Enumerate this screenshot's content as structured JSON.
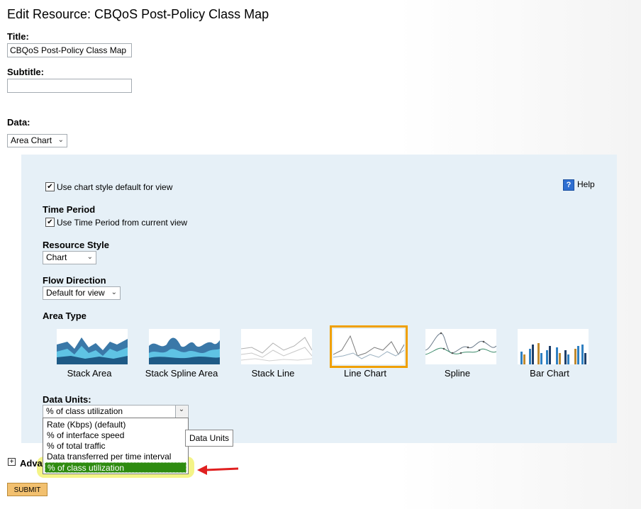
{
  "page": {
    "title": "Edit Resource: CBQoS Post-Policy Class Map"
  },
  "form": {
    "title_label": "Title:",
    "title_value": "CBQoS Post-Policy Class Map",
    "subtitle_label": "Subtitle:",
    "subtitle_value": "",
    "data_label": "Data:",
    "data_select": "Area Chart"
  },
  "panel": {
    "use_chart_style_label": "Use chart style default for view",
    "use_chart_style_checked": true,
    "help_label": "Help",
    "time_period_heading": "Time Period",
    "use_time_period_label": "Use Time Period from current view",
    "use_time_period_checked": true,
    "resource_style_heading": "Resource Style",
    "resource_style_value": "Chart",
    "flow_direction_heading": "Flow Direction",
    "flow_direction_value": "Default for view",
    "area_type_heading": "Area Type",
    "area_types": [
      {
        "label": "Stack Area",
        "icon": "stack-area-icon"
      },
      {
        "label": "Stack Spline Area",
        "icon": "stack-spline-area-icon"
      },
      {
        "label": "Stack Line",
        "icon": "stack-line-icon"
      },
      {
        "label": "Line Chart",
        "icon": "line-chart-icon",
        "selected": true
      },
      {
        "label": "Spline",
        "icon": "spline-icon"
      },
      {
        "label": "Bar Chart",
        "icon": "bar-chart-icon"
      }
    ],
    "data_units_heading": "Data Units:",
    "data_units_value": "% of class utilization",
    "data_units_options": [
      "Rate (Kbps) (default)",
      "% of interface speed",
      "% of total traffic",
      "Data transferred per time interval",
      "% of class utilization"
    ],
    "tooltip": "Data Units"
  },
  "advanced_label": "Adva",
  "submit_label": "SUBMIT",
  "colors": {
    "panel_bg": "#e6f0f7",
    "selection_border": "#f0a000",
    "selected_option": "#2e8b10",
    "annotation_highlight": "#f3f37a",
    "arrow": "#e02020"
  }
}
